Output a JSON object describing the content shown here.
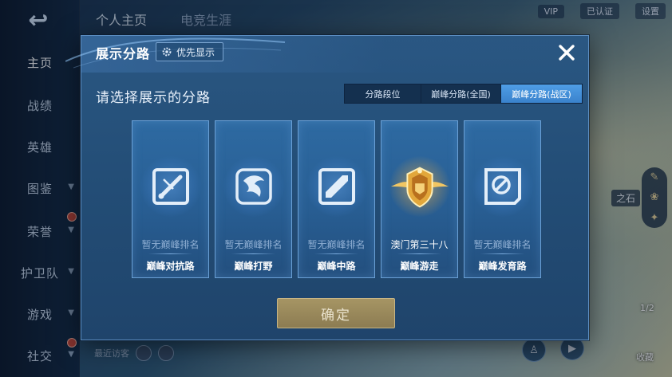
{
  "background": {
    "back_symbol": "↩",
    "nav": [
      {
        "label": "主页",
        "active": true,
        "chevron": false,
        "dot": false
      },
      {
        "label": "战绩",
        "active": false,
        "chevron": false,
        "dot": false
      },
      {
        "label": "英雄",
        "active": false,
        "chevron": false,
        "dot": false
      },
      {
        "label": "图鉴",
        "active": false,
        "chevron": true,
        "dot": false
      },
      {
        "label": "荣誉",
        "active": false,
        "chevron": true,
        "dot": true
      },
      {
        "label": "护卫队",
        "active": false,
        "chevron": true,
        "dot": false
      },
      {
        "label": "游戏",
        "active": false,
        "chevron": true,
        "dot": false
      },
      {
        "label": "社交",
        "active": false,
        "chevron": true,
        "dot": true
      }
    ],
    "tabs": [
      "个人主页",
      "电竞生涯"
    ],
    "top_right": [
      "VIP",
      "已认证",
      "设置"
    ],
    "stone_label": "之石",
    "visitor_label": "最近访客",
    "bottom_right": {
      "btn1_label": "1/2",
      "btn2_label": "收藏"
    }
  },
  "dialog": {
    "title": "展示分路",
    "priority_label": "优先显示",
    "subtitle": "请选择展示的分路",
    "segments": [
      {
        "label": "分路段位",
        "active": false
      },
      {
        "label": "巅峰分路(全国)",
        "active": false
      },
      {
        "label": "巅峰分路(战区)",
        "active": true
      }
    ],
    "cards": [
      {
        "rank": "暂无巅峰排名",
        "name": "巅峰对抗路",
        "icon": "sword-lane-icon",
        "has_rank": false
      },
      {
        "rank": "暂无巅峰排名",
        "name": "巅峰打野",
        "icon": "dragon-jungle-icon",
        "has_rank": false
      },
      {
        "rank": "暂无巅峰排名",
        "name": "巅峰中路",
        "icon": "mid-lane-icon",
        "has_rank": false
      },
      {
        "rank": "澳门第三十八",
        "name": "巅峰游走",
        "icon": "gold-crest-icon",
        "has_rank": true
      },
      {
        "rank": "暂无巅峰排名",
        "name": "巅峰发育路",
        "icon": "adc-lane-icon",
        "has_rank": false
      }
    ],
    "confirm_label": "确定"
  },
  "colors": {
    "dialog_bg": "#234d76",
    "active_tab": "#3a82cc",
    "confirm_btn": "#8c7c52",
    "gold_emblem": "#e7b547"
  }
}
